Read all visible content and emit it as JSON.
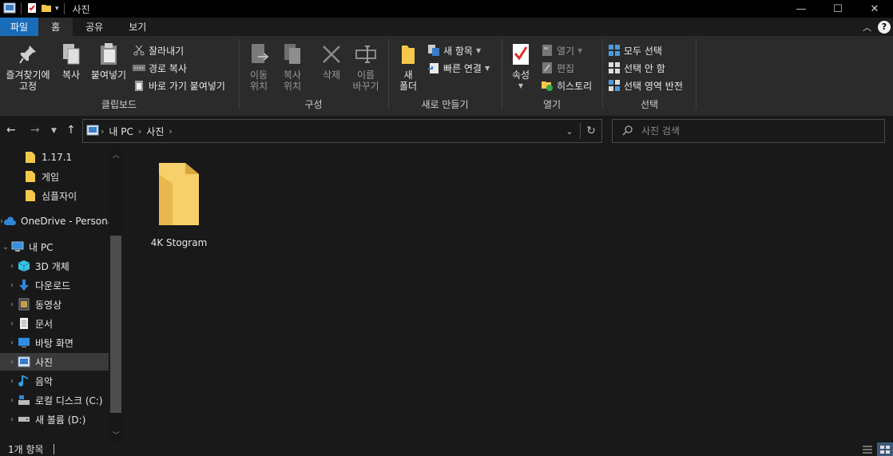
{
  "window": {
    "title": "사진",
    "controls": {
      "minimize": "—",
      "maximize": "☐",
      "close": "✕"
    }
  },
  "ribbon_tabs": [
    {
      "label": "파일"
    },
    {
      "label": "홈"
    },
    {
      "label": "공유"
    },
    {
      "label": "보기"
    }
  ],
  "ribbon": {
    "clipboard": {
      "group_label": "클립보드",
      "pin_line1": "즐겨찾기에",
      "pin_line2": "고정",
      "copy": "복사",
      "paste": "붙여넣기",
      "cut": "잘라내기",
      "copy_path": "경로 복사",
      "paste_shortcut": "바로 가기 붙여넣기"
    },
    "organize": {
      "group_label": "구성",
      "move_line1": "이동",
      "move_line2": "위치",
      "copyto_line1": "복사",
      "copyto_line2": "위치",
      "delete": "삭제",
      "rename_line1": "이름",
      "rename_line2": "바꾸기"
    },
    "new": {
      "group_label": "새로 만들기",
      "folder_line1": "새",
      "folder_line2": "폴더",
      "new_item": "새 항목",
      "easy_access": "빠른 연결"
    },
    "open": {
      "group_label": "열기",
      "properties": "속성",
      "open": "열기",
      "edit": "편집",
      "history": "히스토리"
    },
    "select": {
      "group_label": "선택",
      "select_all": "모두 선택",
      "select_none": "선택 안 함",
      "invert": "선택 영역 반전"
    }
  },
  "address": {
    "crumbs": [
      "내 PC",
      "사진"
    ]
  },
  "search": {
    "placeholder": "사진 검색"
  },
  "sidebar": {
    "items": [
      {
        "label": "1.17.1",
        "icon": "folder-icon"
      },
      {
        "label": "게임",
        "icon": "folder-icon"
      },
      {
        "label": "심플자이",
        "icon": "folder-icon"
      },
      {
        "label": "OneDrive - Personal",
        "icon": "cloud-icon"
      },
      {
        "label": "내 PC",
        "icon": "computer-icon"
      },
      {
        "label": "3D 개체",
        "icon": "cube-icon"
      },
      {
        "label": "다운로드",
        "icon": "download-icon"
      },
      {
        "label": "동영상",
        "icon": "video-icon"
      },
      {
        "label": "문서",
        "icon": "document-icon"
      },
      {
        "label": "바탕 화면",
        "icon": "desktop-icon"
      },
      {
        "label": "사진",
        "icon": "pictures-icon"
      },
      {
        "label": "음악",
        "icon": "music-icon"
      },
      {
        "label": "로컬 디스크 (C:)",
        "icon": "drive-icon"
      },
      {
        "label": "새 볼륨 (D:)",
        "icon": "drive-icon"
      }
    ]
  },
  "files": [
    {
      "name": "4K Stogram",
      "icon": "folder-icon"
    }
  ],
  "status": {
    "count": "1개 항목"
  },
  "colors": {
    "accent": "#1a6cb8",
    "folder": "#f5c84c",
    "background": "#191919"
  }
}
